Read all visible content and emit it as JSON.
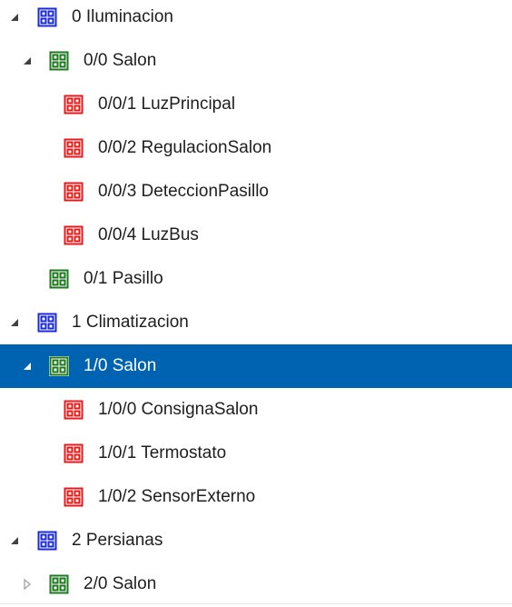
{
  "tree": {
    "colors": {
      "main_group": "#1a2bd4",
      "middle_group": "#1c7a1c",
      "group_address": "#e01b1b",
      "selection": "#0063b1",
      "expander": "#404040",
      "collapsed_expander": "#a0a0a0"
    },
    "rows": [
      {
        "label": "0 Iluminacion",
        "level": 0,
        "kind": "main_group",
        "expander": "expanded",
        "icon": "group-grid-icon"
      },
      {
        "label": "0/0 Salon",
        "level": 1,
        "kind": "middle_group",
        "expander": "expanded",
        "icon": "group-grid-icon"
      },
      {
        "label": "0/0/1 LuzPrincipal",
        "level": 2,
        "kind": "group_address",
        "expander": "none",
        "icon": "group-grid-icon"
      },
      {
        "label": "0/0/2 RegulacionSalon",
        "level": 2,
        "kind": "group_address",
        "expander": "none",
        "icon": "group-grid-icon"
      },
      {
        "label": "0/0/3 DeteccionPasillo",
        "level": 2,
        "kind": "group_address",
        "expander": "none",
        "icon": "group-grid-icon"
      },
      {
        "label": "0/0/4 LuzBus",
        "level": 2,
        "kind": "group_address",
        "expander": "none",
        "icon": "group-grid-icon"
      },
      {
        "label": "0/1 Pasillo",
        "level": 1,
        "kind": "middle_group",
        "expander": "none",
        "icon": "group-grid-icon"
      },
      {
        "label": "1 Climatizacion",
        "level": 0,
        "kind": "main_group",
        "expander": "expanded",
        "icon": "group-grid-icon"
      },
      {
        "label": "1/0 Salon",
        "level": 1,
        "kind": "middle_group",
        "expander": "expanded",
        "icon": "group-grid-icon",
        "selected": true
      },
      {
        "label": "1/0/0 ConsignaSalon",
        "level": 2,
        "kind": "group_address",
        "expander": "none",
        "icon": "group-grid-icon"
      },
      {
        "label": "1/0/1 Termostato",
        "level": 2,
        "kind": "group_address",
        "expander": "none",
        "icon": "group-grid-icon"
      },
      {
        "label": "1/0/2 SensorExterno",
        "level": 2,
        "kind": "group_address",
        "expander": "none",
        "icon": "group-grid-icon"
      },
      {
        "label": "2 Persianas",
        "level": 0,
        "kind": "main_group",
        "expander": "expanded",
        "icon": "group-grid-icon"
      },
      {
        "label": "2/0 Salon",
        "level": 1,
        "kind": "middle_group",
        "expander": "collapsed",
        "icon": "group-grid-icon"
      }
    ]
  }
}
